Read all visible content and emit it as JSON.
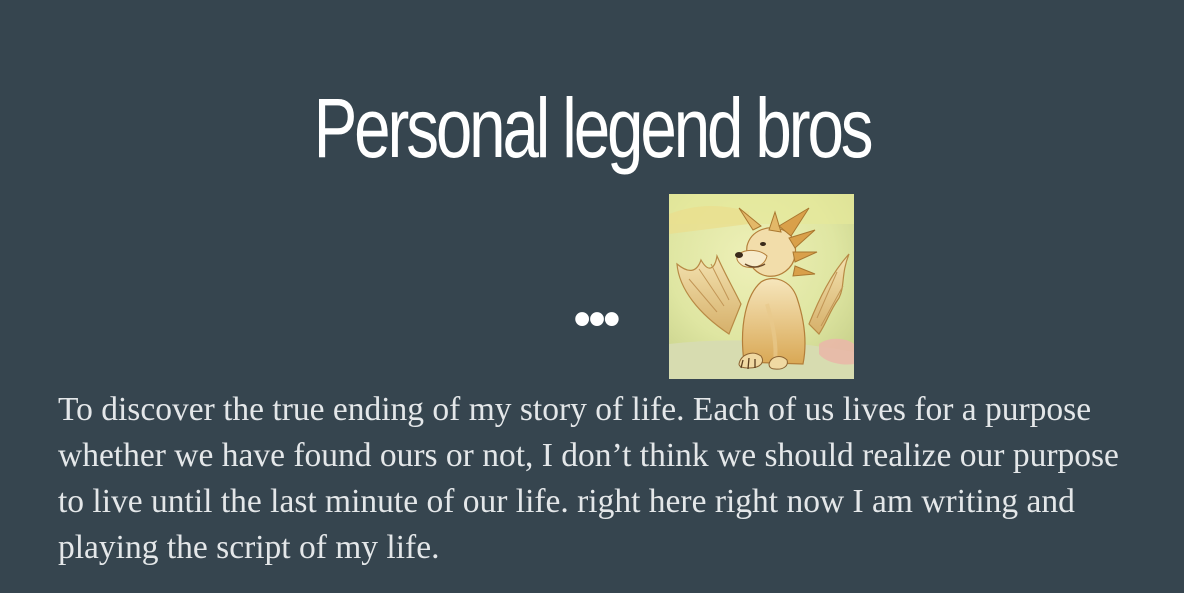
{
  "slide": {
    "title": "Personal legend bros",
    "ellipsis": "•••",
    "body": "To discover the true ending of my story of life. Each of us lives for a purpose whether we have found ours or not, I don’t think we should realize our purpose to live until the last minute of our life. right here right now I am writing and playing the script of my life.",
    "image_icon": "winged-doge-dragon-figurine-icon"
  },
  "colors": {
    "background": "#36454f",
    "title": "#ffffff",
    "body_text": "#e4e7e9"
  }
}
